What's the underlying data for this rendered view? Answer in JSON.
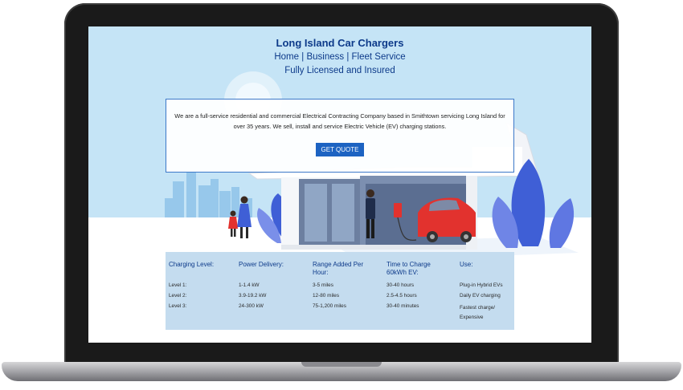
{
  "header": {
    "title": "Long Island Car Chargers",
    "nav": [
      "Home",
      "Business",
      "Fleet Service"
    ],
    "nav_separator": "|",
    "tagline": "Fully Licensed and Insured"
  },
  "intro": {
    "text": "We are a full-service residential and commercial Electrical Contracting Company based in Smithtown servicing Long Island for over 35 years. We sell, install and service Electric Vehicle (EV) charging stations.",
    "button_label": "GET QUOTE"
  },
  "table": {
    "columns": [
      "Charging Level:",
      "Power Delivery:",
      "Range Added Per Hour:",
      "Time to Charge 60kWh EV:",
      "Use:"
    ],
    "rows": [
      [
        "Level 1:",
        "1-1.4 kW",
        "3-5 miles",
        "30-40 hours",
        "Plug-in Hybrid EVs"
      ],
      [
        "Level 2:",
        "3.9-19.2 kW",
        "12-80 miles",
        "2.5-4.5 hours",
        "Daily EV charging"
      ],
      [
        "Level 3:",
        "24-300 kW",
        "75-1,200 miles",
        "30-40 minutes",
        "Fastest charge/ Expensive"
      ]
    ]
  },
  "colors": {
    "screen_background": "#c5e4f6",
    "brand_blue": "#0d3a8a",
    "button_blue": "#1d63c2",
    "table_background": "#c4dcef",
    "car_red": "#e2322e"
  },
  "icons": [
    "laptop-frame",
    "ev-charger-icon",
    "car-illustration",
    "house-illustration"
  ]
}
